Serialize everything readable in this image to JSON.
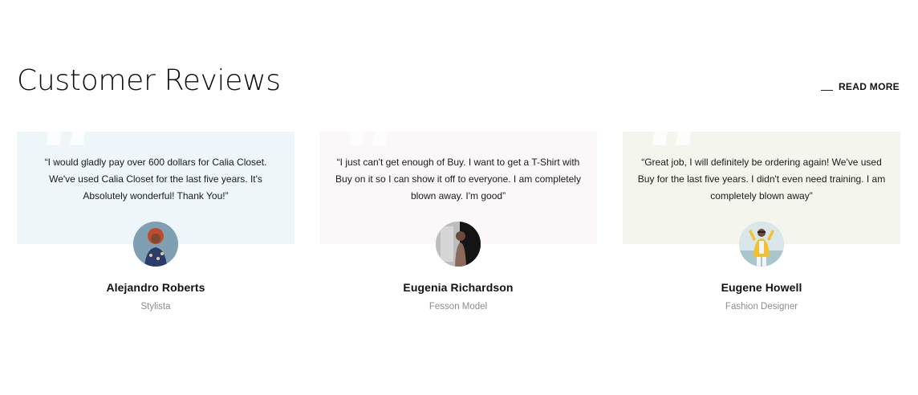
{
  "section": {
    "title": "Customer Reviews",
    "read_more_label": "READ MORE"
  },
  "reviews": [
    {
      "quote": "“I would gladly pay over 600 dollars for Calia Closet. We've used Calia Closet for the last five years. It's Absolutely wonderful! Thank You!”",
      "name": "Alejandro Roberts",
      "role": "Stylista",
      "panel_color": "#eef6f9"
    },
    {
      "quote": "“I just can't get enough of Buy. I want to get a T-Shirt with Buy on it so I can show it off to everyone. I am completely blown away. I'm good”",
      "name": "Eugenia Richardson",
      "role": "Fesson Model",
      "panel_color": "#fcf8f9"
    },
    {
      "quote": "“Great job, I will definitely be ordering again! We've used Buy for the last five years. I didn't even need training. I am completely blown away”",
      "name": "Eugene Howell",
      "role": "Fashion Designer",
      "panel_color": "#f4f6ee"
    }
  ],
  "icons": {
    "quote_mark": "quote-icon",
    "read_more_line": "dash-icon"
  }
}
